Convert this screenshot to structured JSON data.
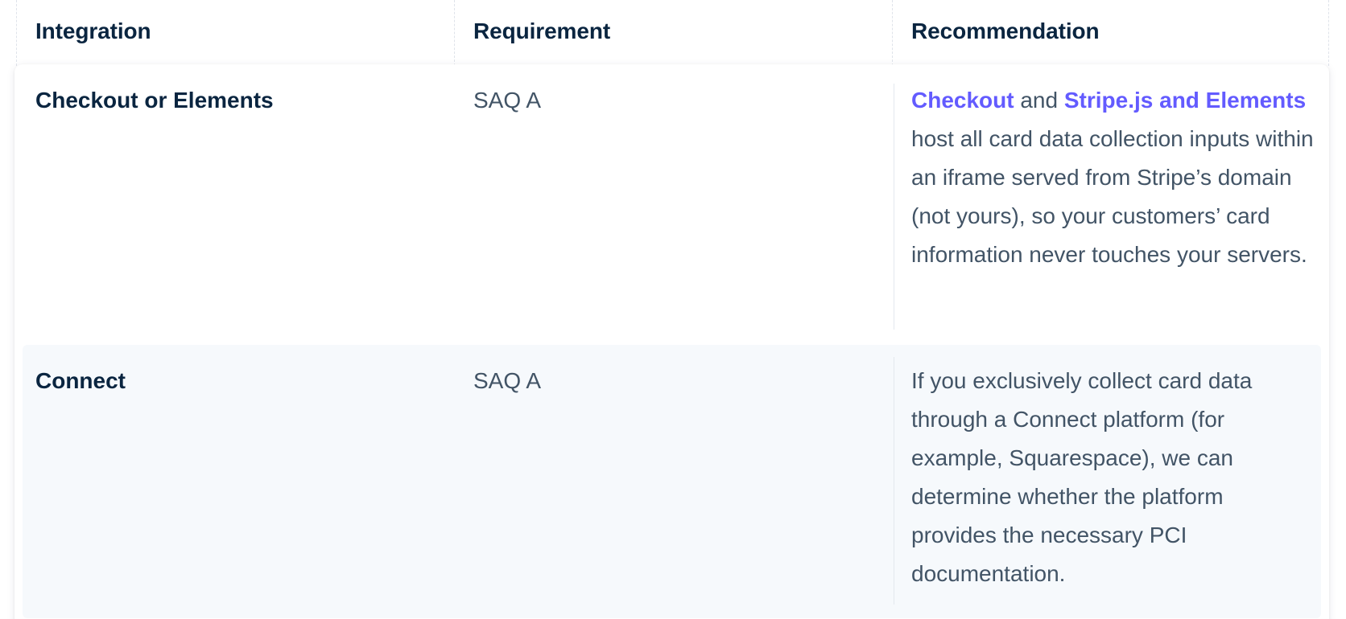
{
  "table": {
    "headers": [
      "Integration",
      "Requirement",
      "Recommendation"
    ],
    "rows": [
      {
        "integration": "Checkout or Elements",
        "requirement": "SAQ A",
        "recommendation": {
          "link1": "Checkout",
          "joiner": " and ",
          "link2": "Stripe.js and Elements",
          "text": " host all card data collection inputs within an iframe served from Stripe’s domain (not yours), so your customers’ card information never touches your servers."
        }
      },
      {
        "integration": "Connect",
        "requirement": "SAQ A",
        "recommendation": {
          "text": "If you exclusively collect card data through a Connect platform (for example, Squarespace), we can determine whether the platform provides the necessary PCI documentation."
        }
      }
    ]
  },
  "colors": {
    "heading": "#0a2540",
    "body": "#425466",
    "link": "#635bff",
    "row_alt_bg": "#f6f9fc"
  }
}
